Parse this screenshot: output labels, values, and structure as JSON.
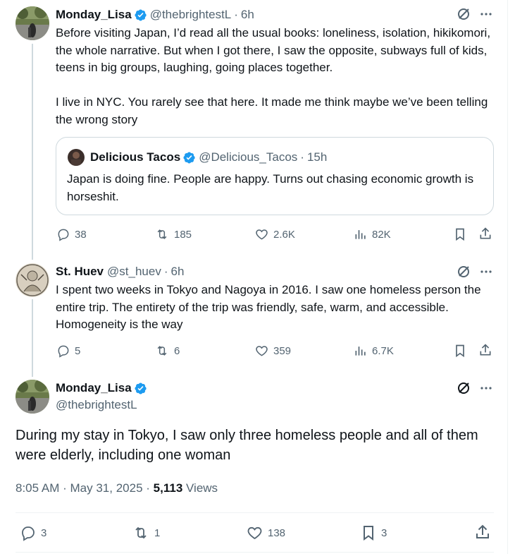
{
  "colors": {
    "accent": "#1d9bf0",
    "text": "#0f1419",
    "secondary": "#536471",
    "border": "#cfd9de"
  },
  "tweet1": {
    "name": "Monday_Lisa",
    "handle": "@thebrightestL",
    "dot": "·",
    "time": "6h",
    "text": "Before visiting Japan, I’d read all the usual books: loneliness, isolation, hikikomori, the whole narrative. But when I got there, I saw the opposite, subways full of kids, teens in big groups, laughing, going places together.\n\nI live in NYC. You rarely see that here. It made me think maybe we’ve been telling the wrong story",
    "quote": {
      "name": "Delicious Tacos",
      "handle": "@Delicious_Tacos",
      "dot": "·",
      "time": "15h",
      "text": "Japan is doing fine. People are happy. Turns out chasing economic growth is horseshit."
    },
    "stats": {
      "replies": "38",
      "reposts": "185",
      "likes": "2.6K",
      "views": "82K"
    }
  },
  "tweet2": {
    "name": "St. Huev",
    "handle": "@st_huev",
    "dot": "·",
    "time": "6h",
    "text": "I spent two weeks in Tokyo and Nagoya in 2016. I saw one homeless person the entire trip. The entirety of the trip was friendly, safe, warm, and accessible. Homogeneity is the way",
    "stats": {
      "replies": "5",
      "reposts": "6",
      "likes": "359",
      "views": "6.7K"
    }
  },
  "main_tweet": {
    "name": "Monday_Lisa",
    "handle": "@thebrightestL",
    "text": "During my stay in Tokyo, I saw only three homeless people and all of them were elderly, including one woman",
    "time": "8:05 AM",
    "dot": "·",
    "date": "May 31, 2025",
    "dot2": "·",
    "views_count": "5,113",
    "views_label": "Views",
    "stats": {
      "replies": "3",
      "reposts": "1",
      "likes": "138",
      "bookmarks": "3"
    }
  },
  "icons": [
    "verified-badge-icon",
    "grok-icon",
    "more-icon",
    "reply-icon",
    "repost-icon",
    "like-icon",
    "views-icon",
    "bookmark-icon",
    "share-icon"
  ]
}
